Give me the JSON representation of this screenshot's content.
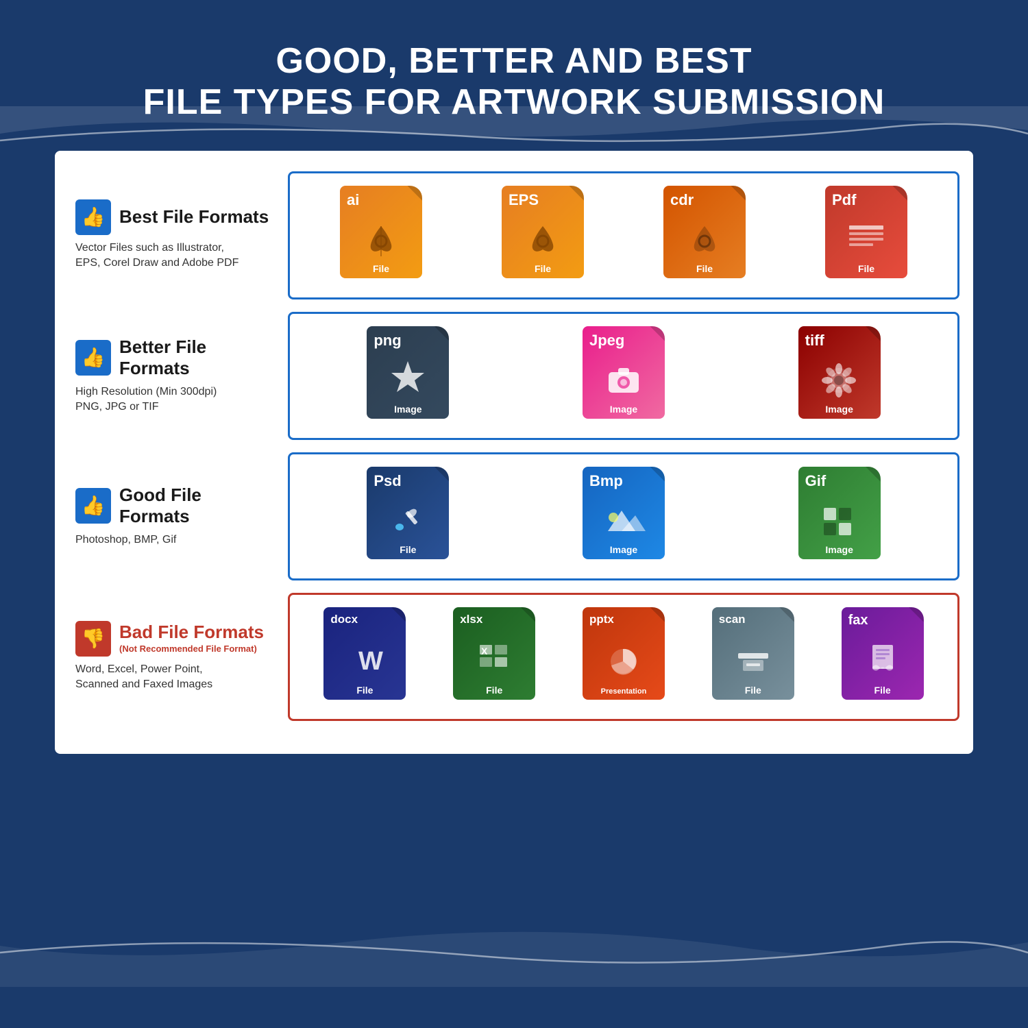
{
  "page": {
    "title_line1": "GOOD, BETTER AND BEST",
    "title_line2": "FILE TYPES FOR ARTWORK SUBMISSION",
    "bg_color": "#1a3a6b"
  },
  "sections": [
    {
      "id": "best",
      "thumb": "up",
      "title": "Best File Formats",
      "subtitle": null,
      "description": "Vector Files such as Illustrator,\nEPS, Corel Draw and Adobe PDF",
      "box_color": "blue",
      "files": [
        {
          "ext": "ai",
          "color": "orange",
          "symbol": "✒",
          "label": "File"
        },
        {
          "ext": "EPS",
          "color": "orange",
          "symbol": "✒",
          "label": "File"
        },
        {
          "ext": "cdr",
          "color": "orange-dark",
          "symbol": "✒",
          "label": "File"
        },
        {
          "ext": "Pdf",
          "color": "red",
          "symbol": "📄",
          "label": "File"
        }
      ]
    },
    {
      "id": "better",
      "thumb": "up",
      "title": "Better File Formats",
      "subtitle": null,
      "description": "High Resolution (Min 300dpi)\nPNG, JPG or TIF",
      "box_color": "blue",
      "files": [
        {
          "ext": "png",
          "color": "dark",
          "symbol": "❋",
          "label": "Image"
        },
        {
          "ext": "Jpeg",
          "color": "pink",
          "symbol": "📷",
          "label": "Image"
        },
        {
          "ext": "tiff",
          "color": "dark-red",
          "symbol": "✿",
          "label": "Image"
        }
      ]
    },
    {
      "id": "good",
      "thumb": "up",
      "title": "Good File Formats",
      "subtitle": null,
      "description": "Photoshop, BMP, Gif",
      "box_color": "blue",
      "files": [
        {
          "ext": "Psd",
          "color": "navy",
          "symbol": "🖌",
          "label": "File"
        },
        {
          "ext": "Bmp",
          "color": "blue",
          "symbol": "🏔",
          "label": "Image"
        },
        {
          "ext": "Gif",
          "color": "green",
          "symbol": "▦",
          "label": "Image"
        }
      ]
    },
    {
      "id": "bad",
      "thumb": "down",
      "title": "Bad File Formats",
      "subtitle": "(Not Recommended File Format)",
      "description": "Word, Excel, Power Point,\nScanned and Faxed Images",
      "box_color": "red",
      "files": [
        {
          "ext": "docx",
          "color": "blue-word",
          "symbol": "W",
          "label": "File"
        },
        {
          "ext": "xlsx",
          "color": "green-excel",
          "symbol": "X",
          "label": "File"
        },
        {
          "ext": "pptx",
          "color": "orange-ppt",
          "symbol": "P",
          "label": "Presentation"
        },
        {
          "ext": "scan",
          "color": "gray-scan",
          "symbol": "⌨",
          "label": "File"
        },
        {
          "ext": "fax",
          "color": "purple-fax",
          "symbol": "📠",
          "label": "File"
        }
      ]
    }
  ]
}
